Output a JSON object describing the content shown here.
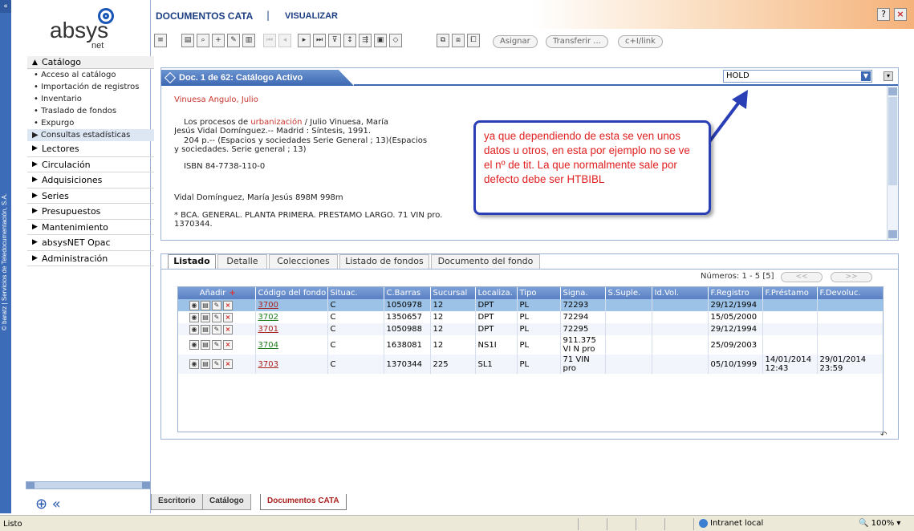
{
  "sidebar": {
    "vertical_text": "© baratz | Servicios de Teledocumentación, S.A.",
    "logo_text": "absys",
    "logo_sub": "net",
    "menu_header": "Catálogo",
    "submenu": [
      "Acceso al catálogo",
      "Importación de registros",
      "Inventario",
      "Traslado de fondos",
      "Expurgo"
    ],
    "submenu_selected": "Consultas estadísticas",
    "items": [
      "Lectores",
      "Circulación",
      "Adquisiciones",
      "Series",
      "Presupuestos",
      "Mantenimiento",
      "absysNET Opac",
      "Administración"
    ]
  },
  "header": {
    "title": "DOCUMENTOS CATA",
    "separator": "|",
    "view": "VISUALIZAR",
    "help": "?",
    "close": "×"
  },
  "toolbar": {
    "asignar": "Asignar",
    "transferir": "Transferir ...",
    "link": "c+I/link"
  },
  "doc": {
    "tab_title": "Doc. 1 de 62: Catálogo Activo",
    "selector_value": "HOLD",
    "author": "Vinuesa Angulo, Julio",
    "line1_a": "Los procesos de ",
    "line1_red": "urbanización",
    "line1_b": " / Julio Vinuesa, María",
    "line2": "Jesús Vidal Domínguez.-- Madrid : Síntesis, 1991.",
    "line3": "204 p.-- (Espacios y sociedades Serie General ; 13)(Espacios",
    "line4": "y sociedades. Serie general ; 13)",
    "isbn": "ISBN 84-7738-110-0",
    "added_entry": "Vidal Domínguez, María Jesús 898M 998m",
    "holding": "* BCA. GENERAL. PLANTA PRIMERA. PRESTAMO LARGO. 71 VIN pro.",
    "holding2": "1370344."
  },
  "callout": {
    "text": "ya que dependiendo de esta  se ven unos datos u otros, en esta por ejemplo no se ve el nº de tit. La que normalmente sale por defecto debe ser HTBIBL"
  },
  "list": {
    "tabs": [
      "Listado",
      "Detalle",
      "Colecciones",
      "Listado de fondos",
      "Documento del fondo"
    ],
    "active_tab": 0,
    "numeros": "Números: 1 - 5 [5]",
    "prev": "<<",
    "next": ">>",
    "add_label": "Añadir",
    "add_plus": "+",
    "columns": [
      "Código del fondo",
      "Situac.",
      "C.Barras",
      "Sucursal",
      "Localiza.",
      "Tipo",
      "Signa.",
      "S.Suple.",
      "Id.Vol.",
      "F.Registro",
      "F.Préstamo",
      "F.Devoluc."
    ],
    "rows": [
      {
        "code": "3700",
        "sit": "C",
        "barras": "1050978",
        "suc": "12",
        "loc": "DPT",
        "tipo": "PL",
        "signa": "72293",
        "supl": "",
        "idvol": "",
        "freg": "29/12/1994",
        "fpres": "",
        "fdev": ""
      },
      {
        "code": "3702",
        "sit": "C",
        "barras": "1350657",
        "suc": "12",
        "loc": "DPT",
        "tipo": "PL",
        "signa": "72294",
        "supl": "",
        "idvol": "",
        "freg": "15/05/2000",
        "fpres": "",
        "fdev": ""
      },
      {
        "code": "3701",
        "sit": "C",
        "barras": "1050988",
        "suc": "12",
        "loc": "DPT",
        "tipo": "PL",
        "signa": "72295",
        "supl": "",
        "idvol": "",
        "freg": "29/12/1994",
        "fpres": "",
        "fdev": ""
      },
      {
        "code": "3704",
        "sit": "C",
        "barras": "1638081",
        "suc": "12",
        "loc": "NS1I",
        "tipo": "PL",
        "signa": "911.375 VI N pro",
        "supl": "",
        "idvol": "",
        "freg": "25/09/2003",
        "fpres": "",
        "fdev": ""
      },
      {
        "code": "3703",
        "sit": "C",
        "barras": "1370344",
        "suc": "225",
        "loc": "SL1",
        "tipo": "PL",
        "signa": "71 VIN pro",
        "supl": "",
        "idvol": "",
        "freg": "05/10/1999",
        "fpres": "14/01/2014 12:43",
        "fdev": "29/01/2014 23:59"
      }
    ]
  },
  "bottom_tabs": [
    "Escritorio",
    "Catálogo",
    "Documentos CATA"
  ],
  "status": {
    "left": "Listo",
    "zone": "Intranet local",
    "zoom": "100%"
  },
  "colors": {
    "accent": "#3d68b3",
    "callout_border": "#2a3fb5",
    "callout_text": "#e02020"
  }
}
